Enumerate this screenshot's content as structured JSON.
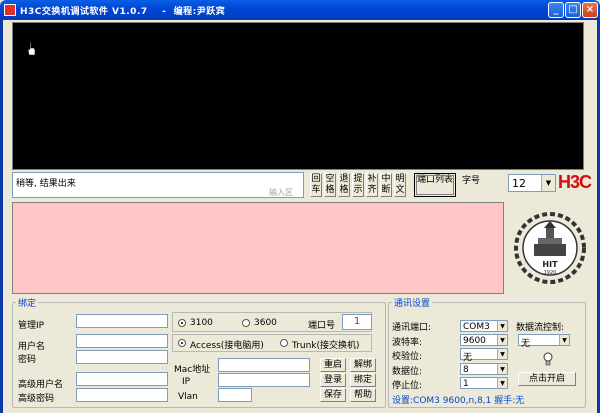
{
  "window": {
    "title": "H3C交换机调试软件 V1.0.7    -  编程:尹跃宾",
    "minimize": "_",
    "maximize": "□",
    "close": "×"
  },
  "input": {
    "text": "稍等, 结果出来",
    "hint": "输入区"
  },
  "side_buttons": [
    {
      "label": "回车"
    },
    {
      "label": "空格"
    },
    {
      "label": "退格"
    },
    {
      "label": "提示"
    },
    {
      "label": "补齐"
    },
    {
      "label": "中断"
    },
    {
      "label": "明文"
    }
  ],
  "port_list_button": "端口列表",
  "font": {
    "label": "字号",
    "value": "12"
  },
  "brand": {
    "logo_text": "H3C",
    "emblem_text": "HIT",
    "emblem_year": "1920"
  },
  "binding": {
    "title": "绑定",
    "mgmt_ip_label": "管理IP",
    "mgmt_ip_value": "",
    "username_label": "用户名",
    "username_value": "",
    "password_label": "密码",
    "password_value": "",
    "adv_user_label": "高级用户名",
    "adv_user_value": "",
    "adv_pass_label": "高级密码",
    "adv_pass_value": "",
    "speed_3100": "3100",
    "speed_3600": "3600",
    "port_no_label": "端口号",
    "port_no_value": "1",
    "access_label": "Access(接电脑用)",
    "trunk_label": "Trunk(接交换机)",
    "mac_label": "Mac地址",
    "ip_label": "IP",
    "vlan_label": "Vlan",
    "mac_value": "",
    "ip_value": "",
    "vlan_value": "",
    "btn_restart": "重启",
    "btn_unbind": "解绑",
    "btn_login": "登录",
    "btn_bind": "绑定",
    "btn_save": "保存",
    "btn_help": "帮助"
  },
  "comm": {
    "title": "通讯设置",
    "port_label": "通讯端口:",
    "port_value": "COM3",
    "baud_label": "波特率:",
    "baud_value": "9600",
    "parity_label": "校验位:",
    "parity_value": "无",
    "databits_label": "数据位:",
    "databits_value": "8",
    "stopbits_label": "停止位:",
    "stopbits_value": "1",
    "flow_label": "数据流控制:",
    "flow_value": "无",
    "open_button": "点击开启",
    "status": "设置:COM3 9600,n,8,1 握手:无"
  },
  "colors": {
    "titlebar": "#0a5fe6",
    "terminal_bg": "#000000",
    "pink_bg": "#ffc6c6",
    "group_title": "#0046d5",
    "logo_red": "#d01010"
  }
}
